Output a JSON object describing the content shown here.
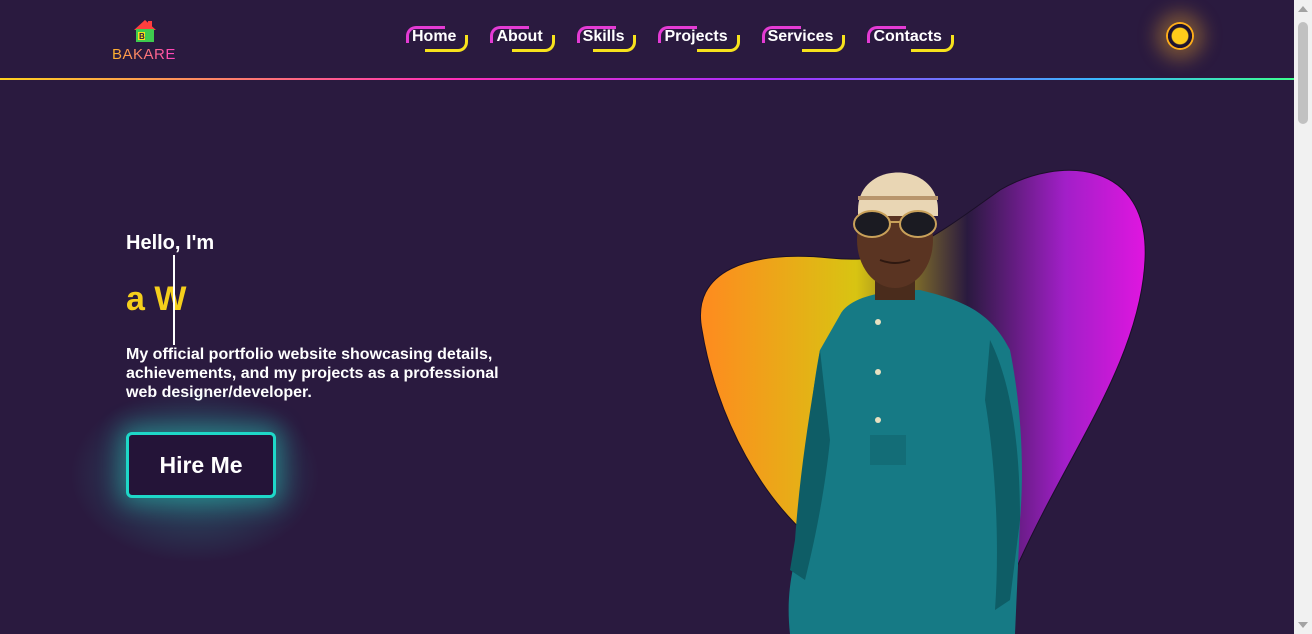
{
  "logo": {
    "text": "BAKARE",
    "badge_letter": "B",
    "icon": "house-logo-icon"
  },
  "nav": {
    "items": [
      {
        "label": "Home"
      },
      {
        "label": "About"
      },
      {
        "label": "Skills"
      },
      {
        "label": "Projects"
      },
      {
        "label": "Services"
      },
      {
        "label": "Contacts"
      }
    ]
  },
  "theme_toggle": {
    "icon": "sun-icon"
  },
  "hero": {
    "greeting": "Hello, I'm",
    "typing_text": "a W",
    "intro": "My official portfolio website showcasing details, achievements, and my projects as a professional web designer/developer.",
    "hire_label": "Hire Me"
  },
  "colors": {
    "background": "#2a1a3f",
    "accent_yellow": "#f5cf1c",
    "accent_pink": "#e43bd4",
    "accent_teal": "#1ed8c8"
  }
}
